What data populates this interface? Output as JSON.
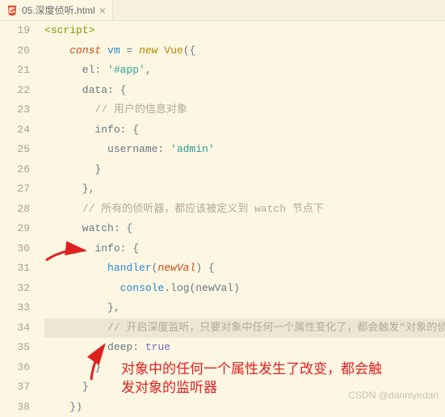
{
  "tab": {
    "filename": "05.深度侦听.html",
    "close_glyph": "×"
  },
  "gutter_start": 19,
  "gutter_end": 38,
  "code_lines": [
    [
      [
        "tok-tag",
        "<"
      ],
      [
        "tok-tag",
        "script"
      ],
      [
        "tok-tag",
        ">"
      ]
    ],
    [
      [
        "",
        "    "
      ],
      [
        "tok-kw",
        "const"
      ],
      [
        "",
        " "
      ],
      [
        "tok-var",
        "vm"
      ],
      [
        "",
        " = "
      ],
      [
        "tok-kw2",
        "new"
      ],
      [
        "",
        " "
      ],
      [
        "tok-cls",
        "Vue"
      ],
      [
        "",
        "({"
      ]
    ],
    [
      [
        "",
        "      el: "
      ],
      [
        "tok-str",
        "'#app'"
      ],
      [
        "",
        ","
      ]
    ],
    [
      [
        "",
        "      data: {"
      ]
    ],
    [
      [
        "",
        "        "
      ],
      [
        "tok-comment",
        "// 用户的信息对象"
      ]
    ],
    [
      [
        "",
        "        info: {"
      ]
    ],
    [
      [
        "",
        "          username: "
      ],
      [
        "tok-str",
        "'admin'"
      ]
    ],
    [
      [
        "",
        "        }"
      ]
    ],
    [
      [
        "",
        "      },"
      ]
    ],
    [
      [
        "",
        "      "
      ],
      [
        "tok-comment",
        "// 所有的侦听器，都应该被定义到 watch 节点下"
      ]
    ],
    [
      [
        "",
        "      watch: {"
      ]
    ],
    [
      [
        "",
        "        info: {"
      ]
    ],
    [
      [
        "",
        "          "
      ],
      [
        "tok-fn",
        "handler"
      ],
      [
        "",
        "("
      ],
      [
        "tok-param",
        "newVal"
      ],
      [
        "",
        ") {"
      ]
    ],
    [
      [
        "",
        "            "
      ],
      [
        "tok-glob",
        "console"
      ],
      [
        "",
        ".log(newVal)"
      ]
    ],
    [
      [
        "",
        "          },"
      ]
    ],
    [
      [
        "",
        "          "
      ],
      [
        "tok-comment",
        "// 开启深度监听，只要对象中任何一个属性变化了，都会触发\"对象的侦听器\""
      ]
    ],
    [
      [
        "",
        "          deep: "
      ],
      [
        "tok-bool",
        "true"
      ]
    ],
    [
      [
        "",
        "        }"
      ]
    ],
    [
      [
        "",
        "      }"
      ]
    ],
    [
      [
        "",
        "    })"
      ]
    ]
  ],
  "annotation": {
    "line1": "对象中的任何一个属性发生了改变，都会触",
    "line2": "发对象的监听器"
  },
  "watermark": "CSDN @danniyedan"
}
